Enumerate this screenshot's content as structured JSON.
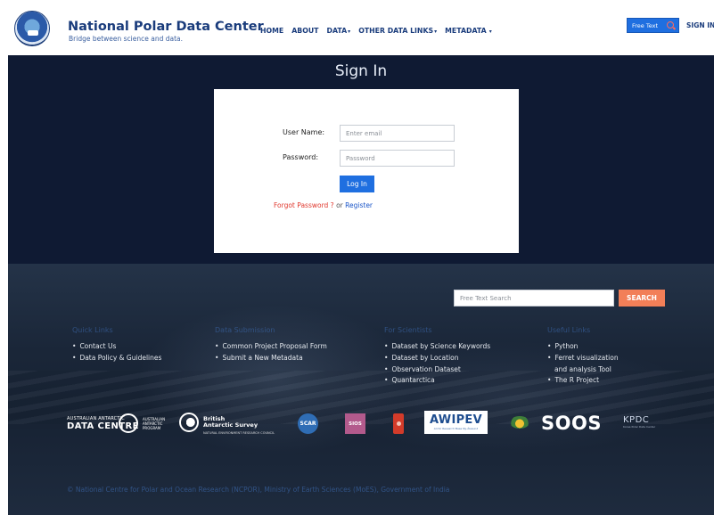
{
  "header": {
    "logo_icon": "ncpor-logo-icon",
    "title": "National Polar Data Center",
    "subtitle": "Bridge between science and data.",
    "nav": [
      {
        "label": "HOME",
        "dropdown": false
      },
      {
        "label": "ABOUT",
        "dropdown": false
      },
      {
        "label": "DATA",
        "dropdown": true
      },
      {
        "label": "OTHER DATA LINKS",
        "dropdown": true
      },
      {
        "label": "METADATA",
        "dropdown": true
      }
    ],
    "free_text_button": "Free Text",
    "search_icon": "search-icon",
    "sign_in": "SIGN IN"
  },
  "signin": {
    "title": "Sign In",
    "username_label": "User Name:",
    "username_placeholder": "Enter email",
    "password_label": "Password:",
    "password_placeholder": "Password",
    "login_button": "Log In",
    "forgot": "Forgot Password ?",
    "or": "or",
    "register": "Register"
  },
  "footer": {
    "search_placeholder": "Free Text Search",
    "search_button": "SEARCH",
    "columns": [
      {
        "title": "Quick Links",
        "items": [
          "Contact Us",
          "Data Policy & Guidelines"
        ]
      },
      {
        "title": "Data Submission",
        "items": [
          "Common Project Proposal Form",
          "Submit a New Metadata"
        ]
      },
      {
        "title": "For Scientists",
        "items": [
          "Dataset by Science Keywords",
          "Dataset by Location",
          "Observation Dataset",
          "Quantarctica"
        ]
      },
      {
        "title": "Useful Links",
        "items": [
          "Python",
          "Ferret visualization",
          "and analysis Tool",
          "The R Project"
        ]
      }
    ],
    "partners": {
      "aadc_small": "AUSTRALIAN ANTARCTIC",
      "aadc_big": "DATA CENTRE",
      "ring_text_1": "AUSTRALIAN",
      "ring_text_2": "ANTARCTIC",
      "ring_text_3": "PROGRAM",
      "bas_1": "British",
      "bas_2": "Antarctic Survey",
      "bas_3": "NATURAL ENVIRONMENT RESEARCH COUNCIL",
      "scar": "SCAR",
      "sios": "SIOS",
      "awipev": "AWIPEV",
      "awipev_sub": "Arctic Research Base Ny-Ålesund",
      "soos": "SOOS",
      "kpdc": "KPDC",
      "kpdc_sub": "Korea Polar Data Center"
    },
    "copyright": "© National Centre for Polar and Ocean Research (NCPOR), Ministry of Earth Sciences (MoES), Government of India"
  },
  "colors": {
    "brand": "#1a3c7c",
    "primary_button": "#1f6fe0",
    "search_button": "#f27f58",
    "signin_bg": "#0f1a33",
    "forgot_link": "#e0382e",
    "register_link": "#1a55c8"
  }
}
